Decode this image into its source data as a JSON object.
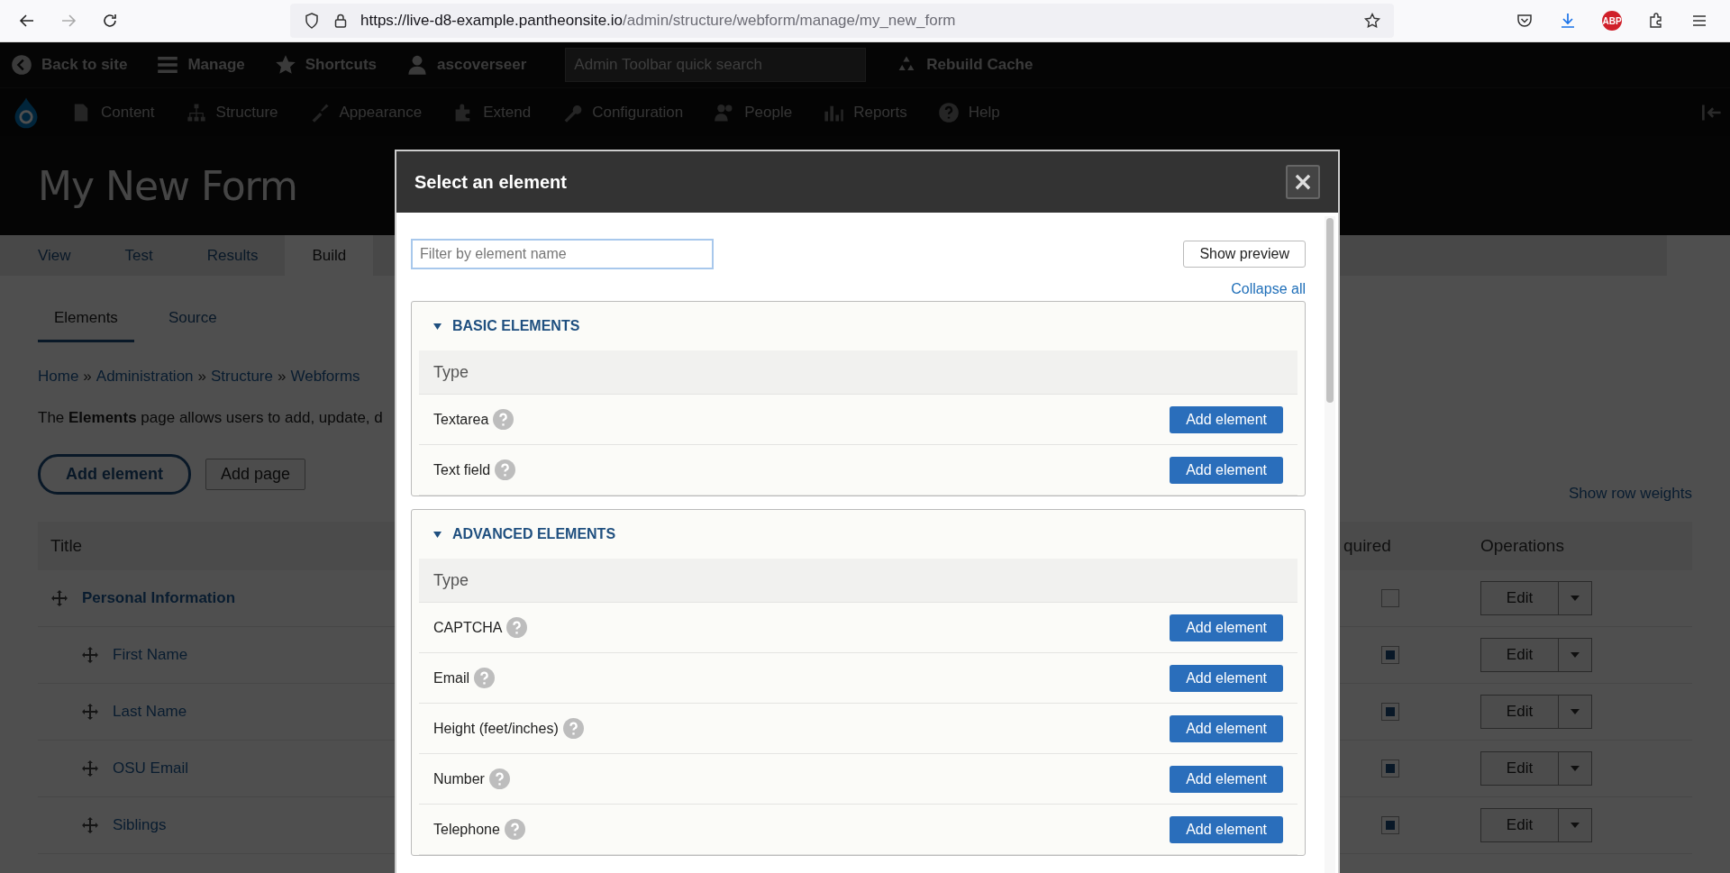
{
  "browser": {
    "url_host": "https://live-d8-example.pantheonsite.io",
    "url_path": "/admin/structure/webform/manage/my_new_form",
    "forward_disabled": true,
    "adblock_badge": "ABP"
  },
  "admin_toolbar": {
    "items": [
      {
        "kind": "back",
        "label": "Back to site"
      },
      {
        "kind": "menu",
        "label": "Manage"
      },
      {
        "kind": "star",
        "label": "Shortcuts"
      },
      {
        "kind": "user",
        "label": "ascoverseer"
      }
    ],
    "search": {
      "placeholder": "Admin Toolbar quick search"
    },
    "rebuild": "Rebuild Cache"
  },
  "nav": {
    "items": [
      {
        "kind": "content",
        "label": "Content"
      },
      {
        "kind": "structure",
        "label": "Structure"
      },
      {
        "kind": "appearance",
        "label": "Appearance"
      },
      {
        "kind": "extend",
        "label": "Extend"
      },
      {
        "kind": "configuration",
        "label": "Configuration"
      },
      {
        "kind": "people",
        "label": "People"
      },
      {
        "kind": "reports",
        "label": "Reports"
      },
      {
        "kind": "help",
        "label": "Help"
      }
    ]
  },
  "page": {
    "title": "My New Form",
    "tabs": [
      {
        "label": "View",
        "selected": false
      },
      {
        "label": "Test",
        "selected": false
      },
      {
        "label": "Results",
        "selected": false
      },
      {
        "label": "Build",
        "selected": true
      }
    ],
    "subtabs": [
      {
        "label": "Elements",
        "selected": true
      },
      {
        "label": "Source",
        "selected": false
      }
    ],
    "breadcrumb": [
      "Home",
      "Administration",
      "Structure",
      "Webforms"
    ],
    "breadcrumb_separator": "»",
    "description": "The **Elements** page allows users to add, update, d",
    "buttons": [
      {
        "kind": "primary",
        "label": "Add element"
      },
      {
        "kind": "secondary",
        "label": "Add page"
      }
    ],
    "show_row_weights": "Show row weights",
    "table": {
      "columns": [
        "Title",
        "quired",
        "Operations"
      ],
      "rows": [
        {
          "title": "Personal Information",
          "required": false,
          "operation": "Edit",
          "children": [
            {
              "title": "First Name",
              "required": true,
              "operation": "Edit"
            },
            {
              "title": "Last Name",
              "required": true,
              "operation": "Edit"
            },
            {
              "title": "OSU Email",
              "required": true,
              "operation": "Edit"
            },
            {
              "title": "Siblings",
              "required": true,
              "operation": "Edit"
            }
          ]
        }
      ]
    }
  },
  "dialog": {
    "title": "Select an element",
    "close": "×",
    "filter": {
      "placeholder": "Filter by element name"
    },
    "show_preview": "Show preview",
    "collapse_all": "Collapse all",
    "sections": [
      {
        "title": "BASIC ELEMENTS",
        "expanded": true,
        "column": "Type",
        "items": [
          {
            "name": "Textarea",
            "action": "Add element"
          },
          {
            "name": "Text field",
            "action": "Add element"
          }
        ]
      },
      {
        "title": "ADVANCED ELEMENTS",
        "expanded": true,
        "column": "Type",
        "items": [
          {
            "name": "CAPTCHA",
            "action": "Add element"
          },
          {
            "name": "Email",
            "action": "Add element"
          },
          {
            "name": "Height (feet/inches)",
            "action": "Add element"
          },
          {
            "name": "Number",
            "action": "Add element"
          },
          {
            "name": "Telephone",
            "action": "Add element"
          }
        ]
      }
    ]
  }
}
